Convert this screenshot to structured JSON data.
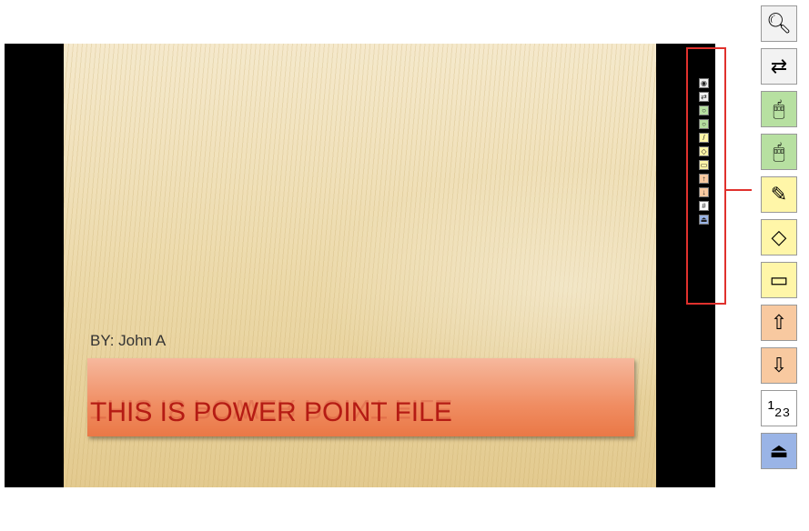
{
  "slide": {
    "byline": "BY: John A",
    "title": "THIS IS POWER POINT FILE"
  },
  "toolbar": {
    "buttons": [
      {
        "name": "zoom-icon",
        "glyph": "🔍︎",
        "color": "#f2f2f2"
      },
      {
        "name": "navigate-arrows-icon",
        "glyph": "⇄",
        "color": "#f2f2f2"
      },
      {
        "name": "mouse-left-icon",
        "glyph": "🖱︎",
        "color": "#b7e0a1"
      },
      {
        "name": "mouse-right-icon",
        "glyph": "🖱︎",
        "color": "#b7e0a1"
      },
      {
        "name": "pen-icon",
        "glyph": "✎",
        "color": "#fff6a8"
      },
      {
        "name": "eraser-icon",
        "glyph": "◇",
        "color": "#fff6a8"
      },
      {
        "name": "clear-ink-icon",
        "glyph": "▭",
        "color": "#fff6a8"
      },
      {
        "name": "previous-page-icon",
        "glyph": "⇧",
        "color": "#f8c9a0"
      },
      {
        "name": "next-page-icon",
        "glyph": "⇩",
        "color": "#f8c9a0"
      },
      {
        "name": "page-number-icon",
        "glyph": "¹₂₃",
        "color": "#ffffff"
      },
      {
        "name": "exit-icon",
        "glyph": "⏏",
        "color": "#9ab4e6"
      }
    ]
  },
  "colors": {
    "highlight": "#e0312d",
    "title_text": "#b51b14"
  }
}
